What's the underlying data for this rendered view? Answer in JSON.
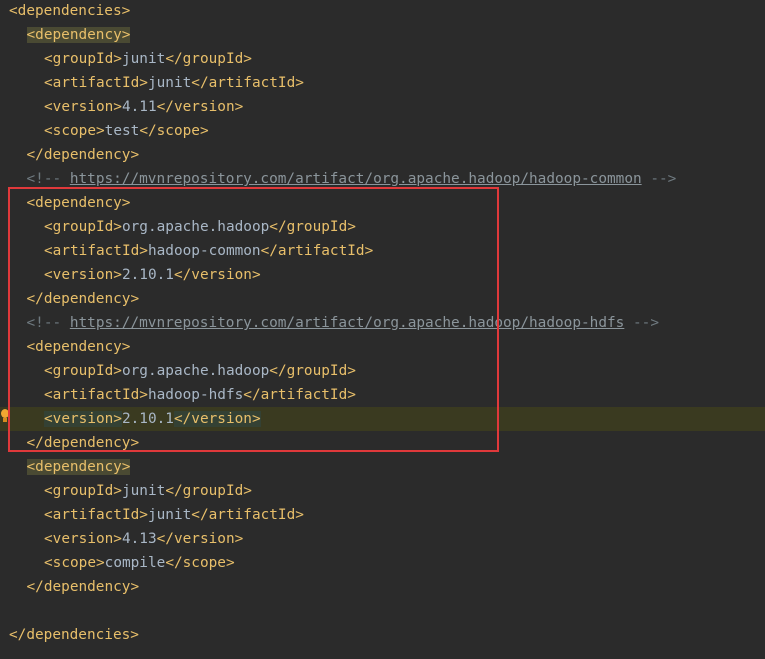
{
  "editor": {
    "language": "XML (pom.xml)",
    "lines": [
      {
        "kind": "tag",
        "indent": 0,
        "open": "<dependencies>",
        "value": "",
        "close": ""
      },
      {
        "kind": "tag",
        "indent": 1,
        "open": "<dependency>",
        "value": "",
        "close": "",
        "highlight": "strong"
      },
      {
        "kind": "tag",
        "indent": 2,
        "open": "<groupId>",
        "value": "junit",
        "close": "</groupId>"
      },
      {
        "kind": "tag",
        "indent": 2,
        "open": "<artifactId>",
        "value": "junit",
        "close": "</artifactId>"
      },
      {
        "kind": "tag",
        "indent": 2,
        "open": "<version>",
        "value": "4.11",
        "close": "</version>"
      },
      {
        "kind": "tag",
        "indent": 2,
        "open": "<scope>",
        "value": "test",
        "close": "</scope>"
      },
      {
        "kind": "tag",
        "indent": 1,
        "open": "</dependency>",
        "value": "",
        "close": ""
      },
      {
        "kind": "comment",
        "indent": 1,
        "before": "<!-- ",
        "link": "https://mvnrepository.com/artifact/org.apache.hadoop/hadoop-common",
        "after": " -->"
      },
      {
        "kind": "tag",
        "indent": 1,
        "open": "<dependency>",
        "value": "",
        "close": ""
      },
      {
        "kind": "tag",
        "indent": 2,
        "open": "<groupId>",
        "value": "org.apache.hadoop",
        "close": "</groupId>"
      },
      {
        "kind": "tag",
        "indent": 2,
        "open": "<artifactId>",
        "value": "hadoop-common",
        "close": "</artifactId>"
      },
      {
        "kind": "tag",
        "indent": 2,
        "open": "<version>",
        "value": "2.10.1",
        "close": "</version>"
      },
      {
        "kind": "tag",
        "indent": 1,
        "open": "</dependency>",
        "value": "",
        "close": ""
      },
      {
        "kind": "comment",
        "indent": 1,
        "before": "<!-- ",
        "link": "https://mvnrepository.com/artifact/org.apache.hadoop/hadoop-hdfs",
        "after": " -->"
      },
      {
        "kind": "tag",
        "indent": 1,
        "open": "<dependency>",
        "value": "",
        "close": ""
      },
      {
        "kind": "tag",
        "indent": 2,
        "open": "<groupId>",
        "value": "org.apache.hadoop",
        "close": "</groupId>"
      },
      {
        "kind": "tag",
        "indent": 2,
        "open": "<artifactId>",
        "value": "hadoop-hdfs",
        "close": "</artifactId>"
      },
      {
        "kind": "tag",
        "indent": 2,
        "open": "<version>",
        "value": "2.10.1",
        "close": "</version>",
        "highlight": "soft",
        "caret": true
      },
      {
        "kind": "tag",
        "indent": 1,
        "open": "</dependency>",
        "value": "",
        "close": ""
      },
      {
        "kind": "tag",
        "indent": 1,
        "open": "<dependency>",
        "value": "",
        "close": "",
        "highlight": "strong"
      },
      {
        "kind": "tag",
        "indent": 2,
        "open": "<groupId>",
        "value": "junit",
        "close": "</groupId>"
      },
      {
        "kind": "tag",
        "indent": 2,
        "open": "<artifactId>",
        "value": "junit",
        "close": "</artifactId>"
      },
      {
        "kind": "tag",
        "indent": 2,
        "open": "<version>",
        "value": "4.13",
        "close": "</version>"
      },
      {
        "kind": "tag",
        "indent": 2,
        "open": "<scope>",
        "value": "compile",
        "close": "</scope>"
      },
      {
        "kind": "tag",
        "indent": 1,
        "open": "</dependency>",
        "value": "",
        "close": ""
      },
      {
        "kind": "blank"
      },
      {
        "kind": "tag",
        "indent": 0,
        "open": "</dependencies>",
        "value": "",
        "close": ""
      }
    ]
  },
  "colors": {
    "background": "#2b2b2b",
    "tag": "#e8bf6a",
    "text": "#a9b7c6",
    "comment": "#6f7a80",
    "caret_line": "#3a3a20",
    "selection_box": "#e0393b"
  },
  "icons": {
    "gutter": "lightbulb-icon"
  }
}
